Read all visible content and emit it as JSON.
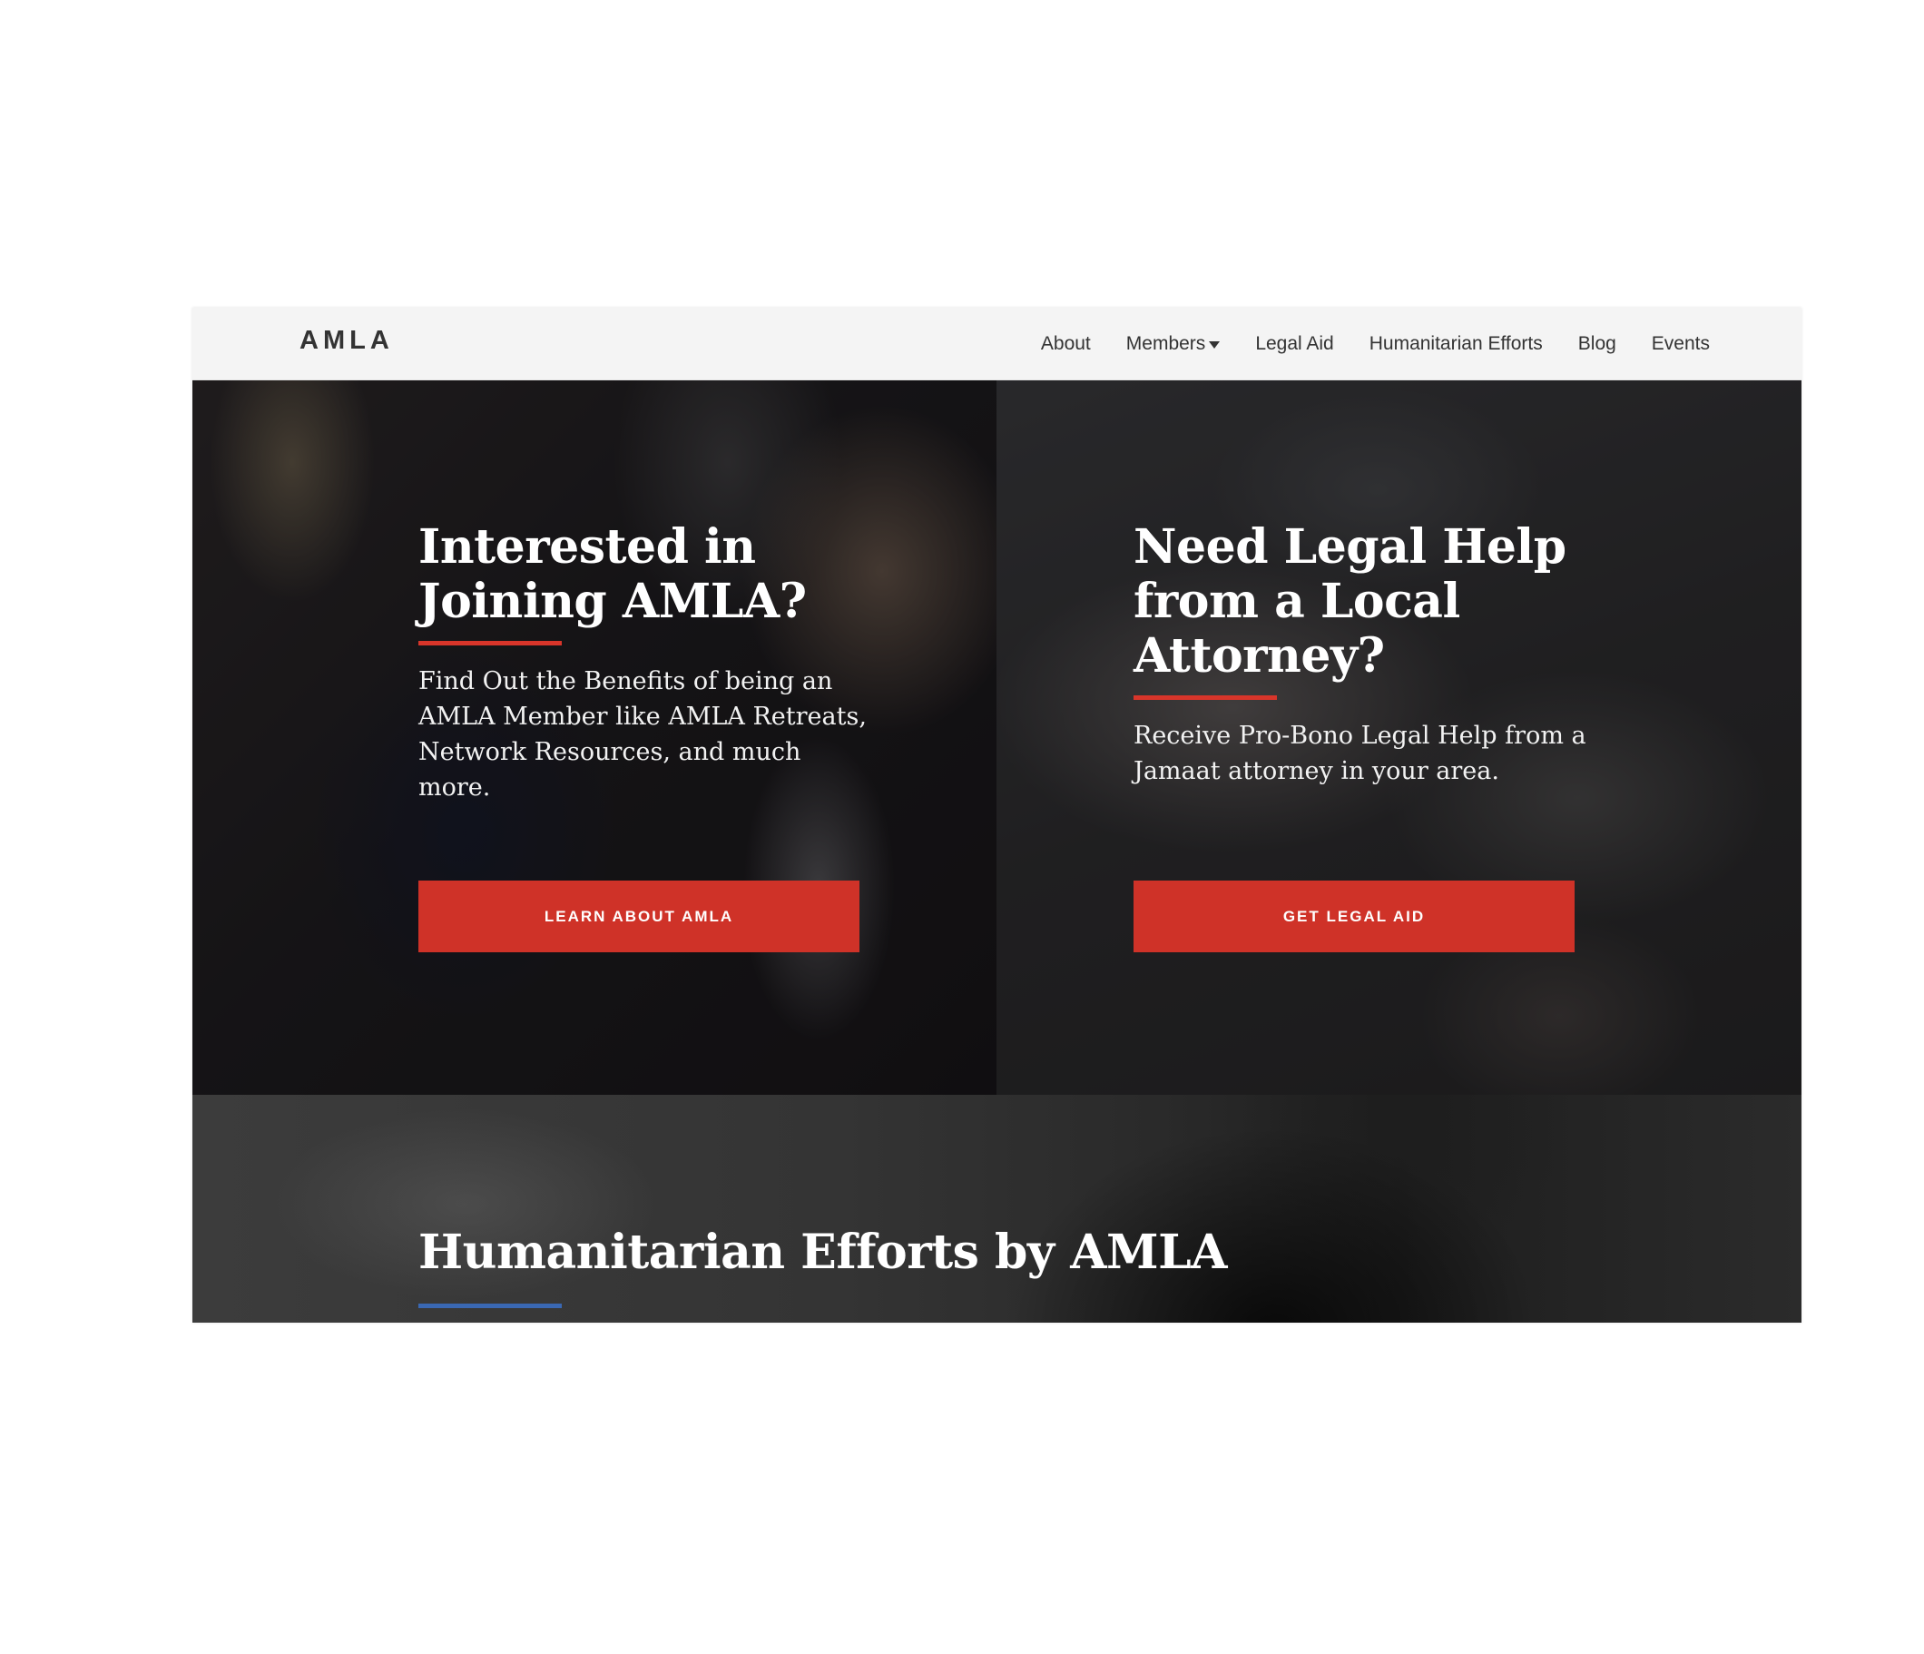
{
  "brand": {
    "logo": "AMLA"
  },
  "nav": {
    "items": [
      {
        "label": "About"
      },
      {
        "label": "Members",
        "has_dropdown": true
      },
      {
        "label": "Legal Aid"
      },
      {
        "label": "Humanitarian Efforts"
      },
      {
        "label": "Blog"
      },
      {
        "label": "Events"
      }
    ]
  },
  "hero": {
    "left": {
      "heading_line1": "Interested in",
      "heading_line2": "Joining AMLA?",
      "body": "Find Out the Benefits of being an AMLA Member like AMLA Retreats, Network Resources, and much more.",
      "button_label": "LEARN ABOUT AMLA"
    },
    "right": {
      "heading_line1": "Need Legal Help",
      "heading_line2": "from a Local",
      "heading_line3": "Attorney?",
      "body": "Receive Pro-Bono Legal Help from a Jamaat attorney in your area.",
      "button_label": "GET LEGAL AID"
    }
  },
  "humanitarian": {
    "heading": "Humanitarian Efforts by AMLA"
  },
  "colors": {
    "accent_red": "#cf3228",
    "underline_red": "#d8352a",
    "underline_blue": "#3a68b3",
    "navbar_bg": "#f4f4f4",
    "nav_text": "#333333"
  },
  "icons": {
    "members_dropdown": "caret-down-icon"
  }
}
